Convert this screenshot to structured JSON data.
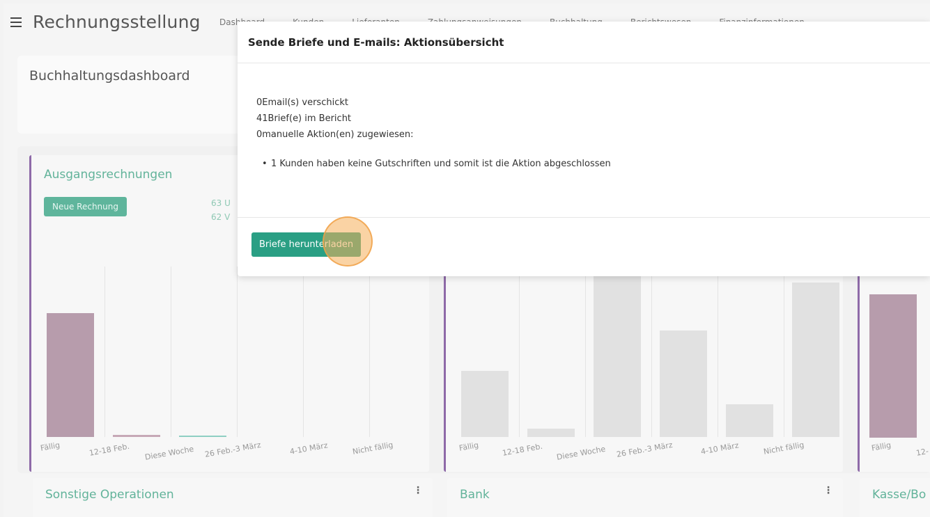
{
  "app": {
    "title": "Rechnungsstellung",
    "nav": [
      "Dashboard",
      "Kunden",
      "Lieferanten",
      "Zahlungsanweisungen",
      "Buchhaltung",
      "Berichtswesen",
      "Finanzinformationen"
    ]
  },
  "dashboard": {
    "title": "Buchhaltungsdashboard"
  },
  "widgets": {
    "ausgang": {
      "title": "Ausgangsrechnungen",
      "button": "Neue Rechnung",
      "stat1": "63 U",
      "stat2": "62 V",
      "xlabels": [
        "Fällig",
        "12-18 Feb.",
        "Diese Woche",
        "26 Feb.-3 März",
        "4-10 März",
        "Nicht fällig"
      ]
    },
    "eingang": {
      "xlabels": [
        "Fällig",
        "12-18 Feb.",
        "Diese Woche",
        "26 Feb.-3 März",
        "4-10 März",
        "Nicht fällig"
      ]
    },
    "third": {
      "xlabels": [
        "Fällig",
        "12-"
      ]
    },
    "sonstige": {
      "title": "Sonstige Operationen"
    },
    "bank": {
      "title": "Bank"
    },
    "kasse": {
      "title": "Kasse/Bo"
    }
  },
  "modal": {
    "title": "Sende Briefe und E-mails: Aktionsübersicht",
    "line1": "0Email(s) verschickt",
    "line2": "41Brief(e) im Bericht",
    "line3": "0manuelle Aktion(en) zugewiesen:",
    "bullet1": "1 Kunden haben keine Gutschriften und somit ist die Aktion abgeschlossen",
    "download_button": "Briefe herunterladen"
  },
  "colors": {
    "accent": "#2a9f84",
    "widget_title": "#62b39a",
    "widget_border": "#8e6aa8",
    "bar_overdue": "#b79cac",
    "bar_neutral": "#e1e1e1",
    "click_highlight": "#f5af5a"
  }
}
